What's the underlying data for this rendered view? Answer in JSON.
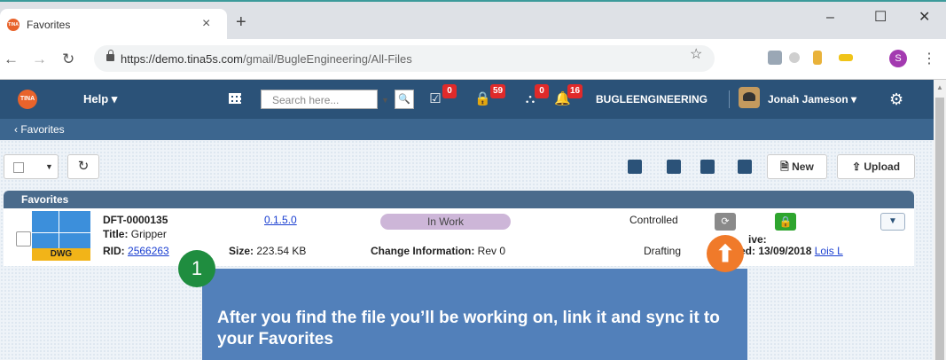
{
  "browser": {
    "tab_title": "Favorites",
    "tab_favicon": "TINA",
    "new_tab": "+",
    "tab_close": "×",
    "url_host": "https://demo.tina5s.com",
    "url_path": "/gmail/BugleEngineering/All-Files",
    "profile_initial": "S",
    "window_controls": {
      "minimize": "–",
      "maximize": "☐",
      "close": "✕"
    }
  },
  "topnav": {
    "logo": "TINA",
    "help": "Help ▾",
    "search_placeholder": "Search here...",
    "badges": {
      "tasks": "0",
      "locks": "59",
      "workflow": "0",
      "notifications": "16"
    },
    "company": "BUGLEENGINEERING",
    "user": "Jonah Jameson ▾"
  },
  "subbar": {
    "back_label": "‹  Favorites"
  },
  "toolbar": {
    "new_label": "New",
    "upload_label": "Upload"
  },
  "panel": {
    "title": "Favorites"
  },
  "file": {
    "number": "DFT-0000135",
    "title_label": "Title:",
    "title_value": "Gripper",
    "file_type": "DWG",
    "rid_label": "RID:",
    "rid_value": "2566263",
    "version": "0.1.5.0",
    "size_label": "Size:",
    "size_value": "223.54 KB",
    "status": "In Work",
    "change_label": "Change Information:",
    "change_value": "Rev 0",
    "control": "Controlled",
    "stage": "Drafting",
    "active_fragment": "ive:",
    "date_fragment": "ed: 13/09/2018",
    "owner": "Lois L"
  },
  "callout": {
    "step": "1",
    "text": "After you find the file you’ll be working on, link it and sync it to your Favorites"
  },
  "colors": {
    "nav": "#2b5278",
    "callout": "#5280ba",
    "orange": "#f07a2a",
    "step": "#1f8d3f"
  }
}
